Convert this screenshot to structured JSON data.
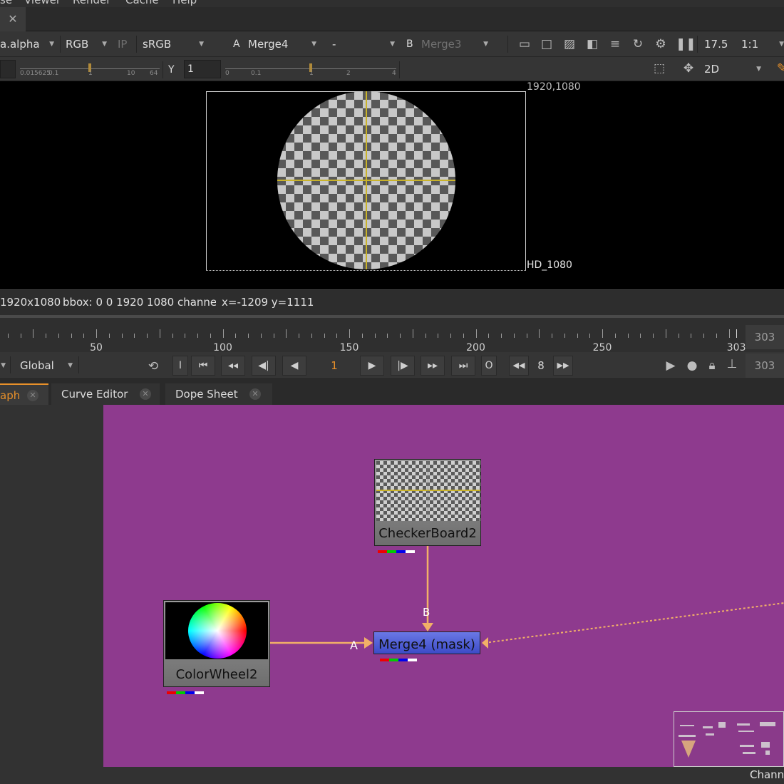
{
  "menu": [
    "se",
    "Viewer",
    "Render",
    "Cache",
    "Help"
  ],
  "viewer_tab": {
    "close": "✕"
  },
  "toolbar1": {
    "channel_layer": "a.alpha",
    "channels": "RGB",
    "ip": "IP",
    "lut": "sRGB",
    "a_label": "A",
    "a_input": "Merge4",
    "op": "-",
    "b_label": "B",
    "b_input": "Merge3",
    "zoom": "17.5",
    "ratio": "1:1"
  },
  "toolbar2": {
    "gain_labels": [
      "0.015625",
      "0.1",
      "1",
      "10",
      "64"
    ],
    "gamma_label": "Y",
    "gamma_value": "1",
    "gamma_ticks": [
      "0",
      "0.1",
      "1",
      "2",
      "4"
    ],
    "view_mode": "2D"
  },
  "viewer": {
    "format_top_right": "1920,1080",
    "format_name": "HD_1080"
  },
  "info": {
    "resolution": "1920x1080",
    "bbox": "bbox: 0 0 1920 1080 channe",
    "coords": "x=-1209 y=1111"
  },
  "timeline": {
    "labels": [
      "50",
      "100",
      "150",
      "200",
      "250",
      "303"
    ],
    "end_frame": "303",
    "out_frame": "303"
  },
  "playback": {
    "scope": "Global",
    "current_frame": "1",
    "increment": "8",
    "in_btn": "I",
    "out_btn": "O"
  },
  "tabs": [
    {
      "label": "aph"
    },
    {
      "label": "Curve Editor"
    },
    {
      "label": "Dope Sheet"
    }
  ],
  "nodes": {
    "checker": "CheckerBoard2",
    "colorwheel": "ColorWheel2",
    "merge": "Merge4 (mask)",
    "input_a": "A",
    "input_b": "B"
  },
  "bottom_label": "Chann",
  "colors": {
    "nodegraph_bg": "#8e3a8e",
    "merge_node": "#4a58d8",
    "pipe": "#f2b067",
    "active_tab": "#e8902a",
    "current_frame": "#e8902a"
  }
}
